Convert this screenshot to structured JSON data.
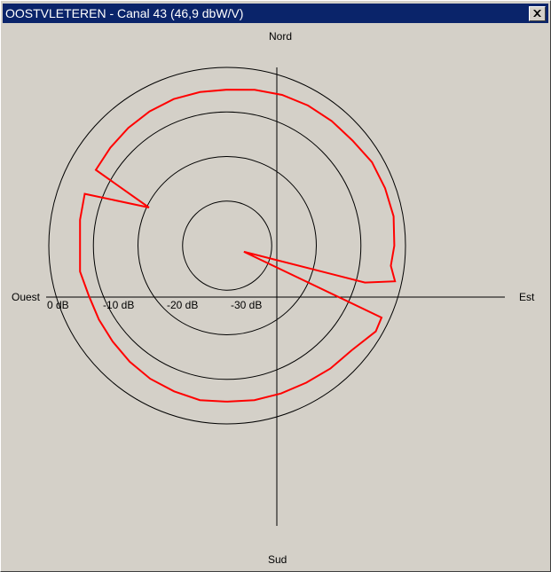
{
  "window": {
    "title": "OOSTVLETEREN - Canal 43 (46,9 dbW/V)",
    "close_icon": "close-icon"
  },
  "compass": {
    "north": "Nord",
    "south": "Sud",
    "east": "Est",
    "west": "Ouest"
  },
  "chart_data": {
    "type": "polar",
    "rings": [
      "0 dB",
      "-10 dB",
      "-20 dB",
      "-30 dB"
    ],
    "ring_values_db": [
      0,
      -10,
      -20,
      -30
    ],
    "rmin_db": -40,
    "series": [
      {
        "color": "#ff0000",
        "points": [
          {
            "bearing": 0,
            "db": -5.0
          },
          {
            "bearing": 10,
            "db": -4.5
          },
          {
            "bearing": 20,
            "db": -4.0
          },
          {
            "bearing": 30,
            "db": -3.7
          },
          {
            "bearing": 40,
            "db": -3.5
          },
          {
            "bearing": 50,
            "db": -3.3
          },
          {
            "bearing": 60,
            "db": -2.5
          },
          {
            "bearing": 70,
            "db": -2.3
          },
          {
            "bearing": 80,
            "db": -2.1
          },
          {
            "bearing": 90,
            "db": -2.5
          },
          {
            "bearing": 97,
            "db": -3.0
          },
          {
            "bearing": 102,
            "db": -1.5
          },
          {
            "bearing": 105,
            "db": -8.0
          },
          {
            "bearing": 110,
            "db": -36.0
          },
          {
            "bearing": 115,
            "db": -1.8
          },
          {
            "bearing": 120,
            "db": -1.5
          },
          {
            "bearing": 130,
            "db": -3.5
          },
          {
            "bearing": 140,
            "db": -4.0
          },
          {
            "bearing": 150,
            "db": -4.5
          },
          {
            "bearing": 160,
            "db": -4.7
          },
          {
            "bearing": 170,
            "db": -4.8
          },
          {
            "bearing": 180,
            "db": -5.0
          },
          {
            "bearing": 190,
            "db": -4.8
          },
          {
            "bearing": 200,
            "db": -5.2
          },
          {
            "bearing": 210,
            "db": -5.5
          },
          {
            "bearing": 220,
            "db": -6.0
          },
          {
            "bearing": 230,
            "db": -6.5
          },
          {
            "bearing": 240,
            "db": -6.8
          },
          {
            "bearing": 250,
            "db": -7.0
          },
          {
            "bearing": 260,
            "db": -6.5
          },
          {
            "bearing": 270,
            "db": -7.0
          },
          {
            "bearing": 280,
            "db": -6.5
          },
          {
            "bearing": 290,
            "db": -6.0
          },
          {
            "bearing": 296,
            "db": -20.5
          },
          {
            "bearing": 300,
            "db": -6.0
          },
          {
            "bearing": 310,
            "db": -5.8
          },
          {
            "bearing": 320,
            "db": -5.5
          },
          {
            "bearing": 330,
            "db": -5.2
          },
          {
            "bearing": 340,
            "db": -5.0
          },
          {
            "bearing": 350,
            "db": -5.0
          }
        ]
      }
    ]
  }
}
